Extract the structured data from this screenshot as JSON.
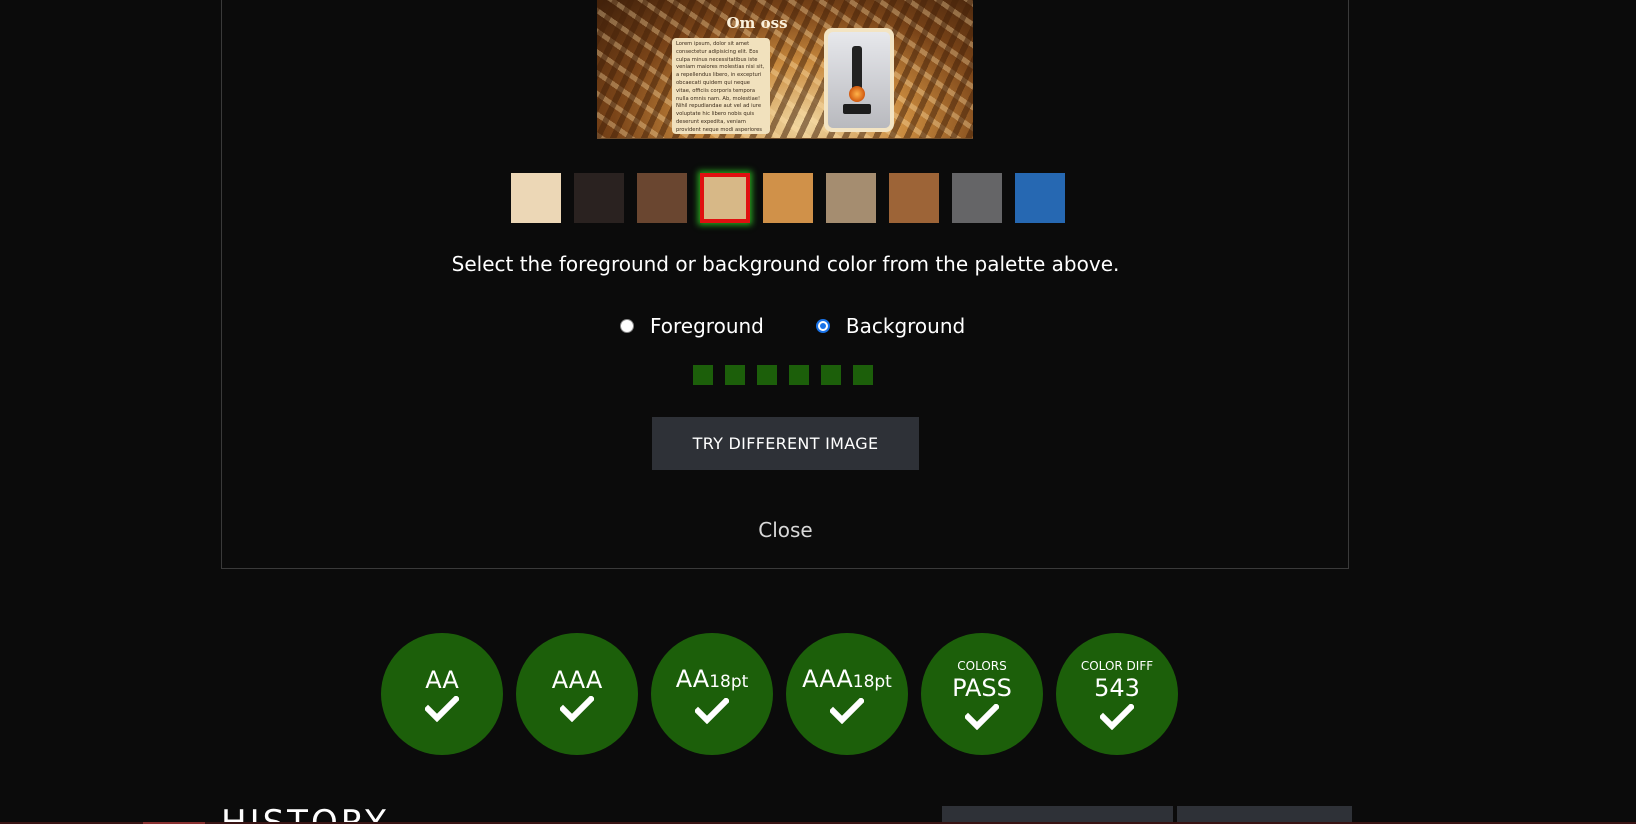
{
  "preview": {
    "title": "Om oss",
    "body": "Lorem ipsum, dolor sit amet consectetur adipisicing elit. Eos culpa minus necessitatibus iste veniam maiores molestias nisi sit, a repellendus libero, in excepturi obcaecati quidem qui neque vitae, officiis corporis tempora nulla omnis nam. Ab, molestiae! Nihil repudiandae aut vel ad iure voluptate hic libero nobis quis deserunt expedita, veniam provident neque modi asperiores excepturi velit ipsam sint! Magni, eaque eos consectetur soluta."
  },
  "palette": {
    "swatches": [
      {
        "color": "#ecd7b6",
        "selected": false
      },
      {
        "color": "#2a2220",
        "selected": false
      },
      {
        "color": "#6a4630",
        "selected": false
      },
      {
        "color": "#d7b887",
        "selected": true
      },
      {
        "color": "#d09149",
        "selected": false
      },
      {
        "color": "#a58d70",
        "selected": false
      },
      {
        "color": "#9d6437",
        "selected": false
      },
      {
        "color": "#656567",
        "selected": false
      },
      {
        "color": "#2668b2",
        "selected": false
      }
    ],
    "instruction": "Select the foreground or background color from the palette above."
  },
  "mode": {
    "foreground_label": "Foreground",
    "background_label": "Background",
    "selected": "Background"
  },
  "progress": {
    "steps": 6,
    "color": "#1c5f0a"
  },
  "actions": {
    "try_label": "TRY DIFFERENT IMAGE",
    "close_label": "Close"
  },
  "results": [
    {
      "small": "",
      "main": "AA",
      "sub": "",
      "status": "pass"
    },
    {
      "small": "",
      "main": "AAA",
      "sub": "",
      "status": "pass"
    },
    {
      "small": "",
      "main": "AA",
      "sub": "18pt",
      "status": "pass"
    },
    {
      "small": "",
      "main": "AAA",
      "sub": "18pt",
      "status": "pass"
    },
    {
      "small": "COLORS",
      "main": "PASS",
      "sub": "",
      "status": "pass"
    },
    {
      "small": "COLOR DIFF",
      "main": "543",
      "sub": "",
      "status": "pass"
    }
  ],
  "history": {
    "title": "HISTORY"
  },
  "colors": {
    "pass_green": "#1c5f0a",
    "button_bg": "#2e3137",
    "selected_border": "#e01010"
  }
}
